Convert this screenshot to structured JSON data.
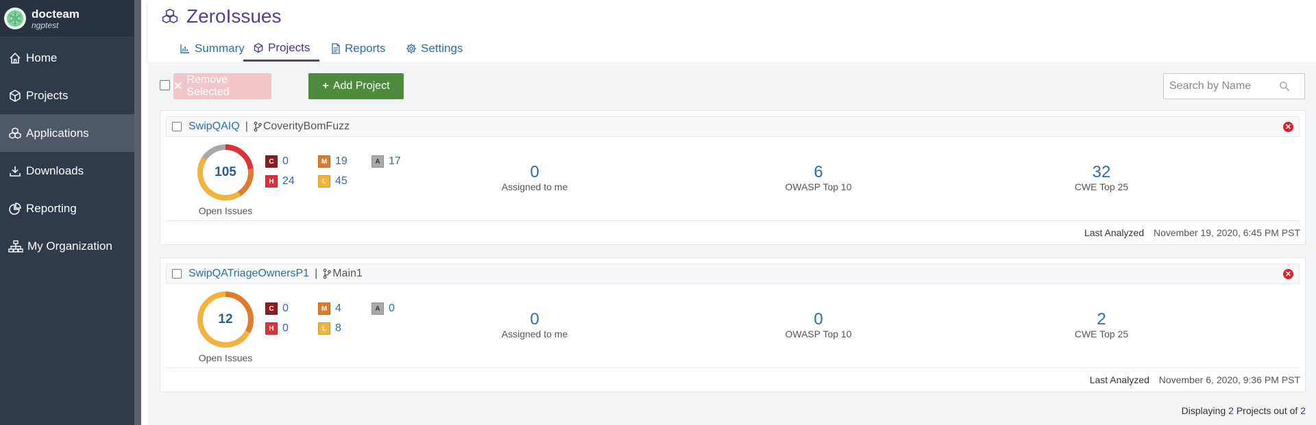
{
  "sidebar": {
    "org": "docteam",
    "user": "ngptest",
    "items": [
      {
        "label": "Home",
        "icon": "home-icon"
      },
      {
        "label": "Projects",
        "icon": "cube-icon"
      },
      {
        "label": "Applications",
        "icon": "applications-icon",
        "active": true
      },
      {
        "label": "Downloads",
        "icon": "download-icon"
      },
      {
        "label": "Reporting",
        "icon": "pie-chart-icon"
      },
      {
        "label": "My Organization",
        "icon": "org-chart-icon"
      }
    ]
  },
  "header": {
    "title": "ZeroIssues",
    "tabs": [
      {
        "label": "Summary",
        "icon": "bar-chart-icon"
      },
      {
        "label": "Projects",
        "icon": "cube-icon",
        "active": true
      },
      {
        "label": "Reports",
        "icon": "document-icon"
      },
      {
        "label": "Settings",
        "icon": "gear-icon"
      }
    ]
  },
  "toolbar": {
    "remove_label": "Remove Selected",
    "add_label": "Add Project",
    "search_placeholder": "Search by Name"
  },
  "projects": [
    {
      "name": "SwipQAIQ",
      "branch": "CoverityBomFuzz",
      "open_issues": "105",
      "open_label": "Open Issues",
      "severity": {
        "C": "0",
        "H": "24",
        "M": "19",
        "L": "45",
        "A": "17"
      },
      "assigned": "0",
      "assigned_label": "Assigned to me",
      "owasp": "6",
      "owasp_label": "OWASP Top 10",
      "cwe": "32",
      "cwe_label": "CWE Top 25",
      "last_analyzed_label": "Last Analyzed",
      "last_analyzed": "November 19, 2020, 6:45 PM PST"
    },
    {
      "name": "SwipQATriageOwnersP1",
      "branch": "Main1",
      "open_issues": "12",
      "open_label": "Open Issues",
      "severity": {
        "C": "0",
        "H": "0",
        "M": "4",
        "L": "8",
        "A": "0"
      },
      "assigned": "0",
      "assigned_label": "Assigned to me",
      "owasp": "0",
      "owasp_label": "OWASP Top 10",
      "cwe": "2",
      "cwe_label": "CWE Top 25",
      "last_analyzed_label": "Last Analyzed",
      "last_analyzed": "November 6, 2020, 9:36 PM PST"
    }
  ],
  "footer": {
    "prefix": "Displaying",
    "shown": "2",
    "middle": "Projects out of",
    "total": "2"
  },
  "colors": {
    "critical": "#8b1d1d",
    "high": "#d9323a",
    "medium": "#e07b2b",
    "low": "#f2b23e",
    "audit": "#a9a9a9",
    "brand": "#5b3c8e",
    "link": "#2e6ca8"
  }
}
